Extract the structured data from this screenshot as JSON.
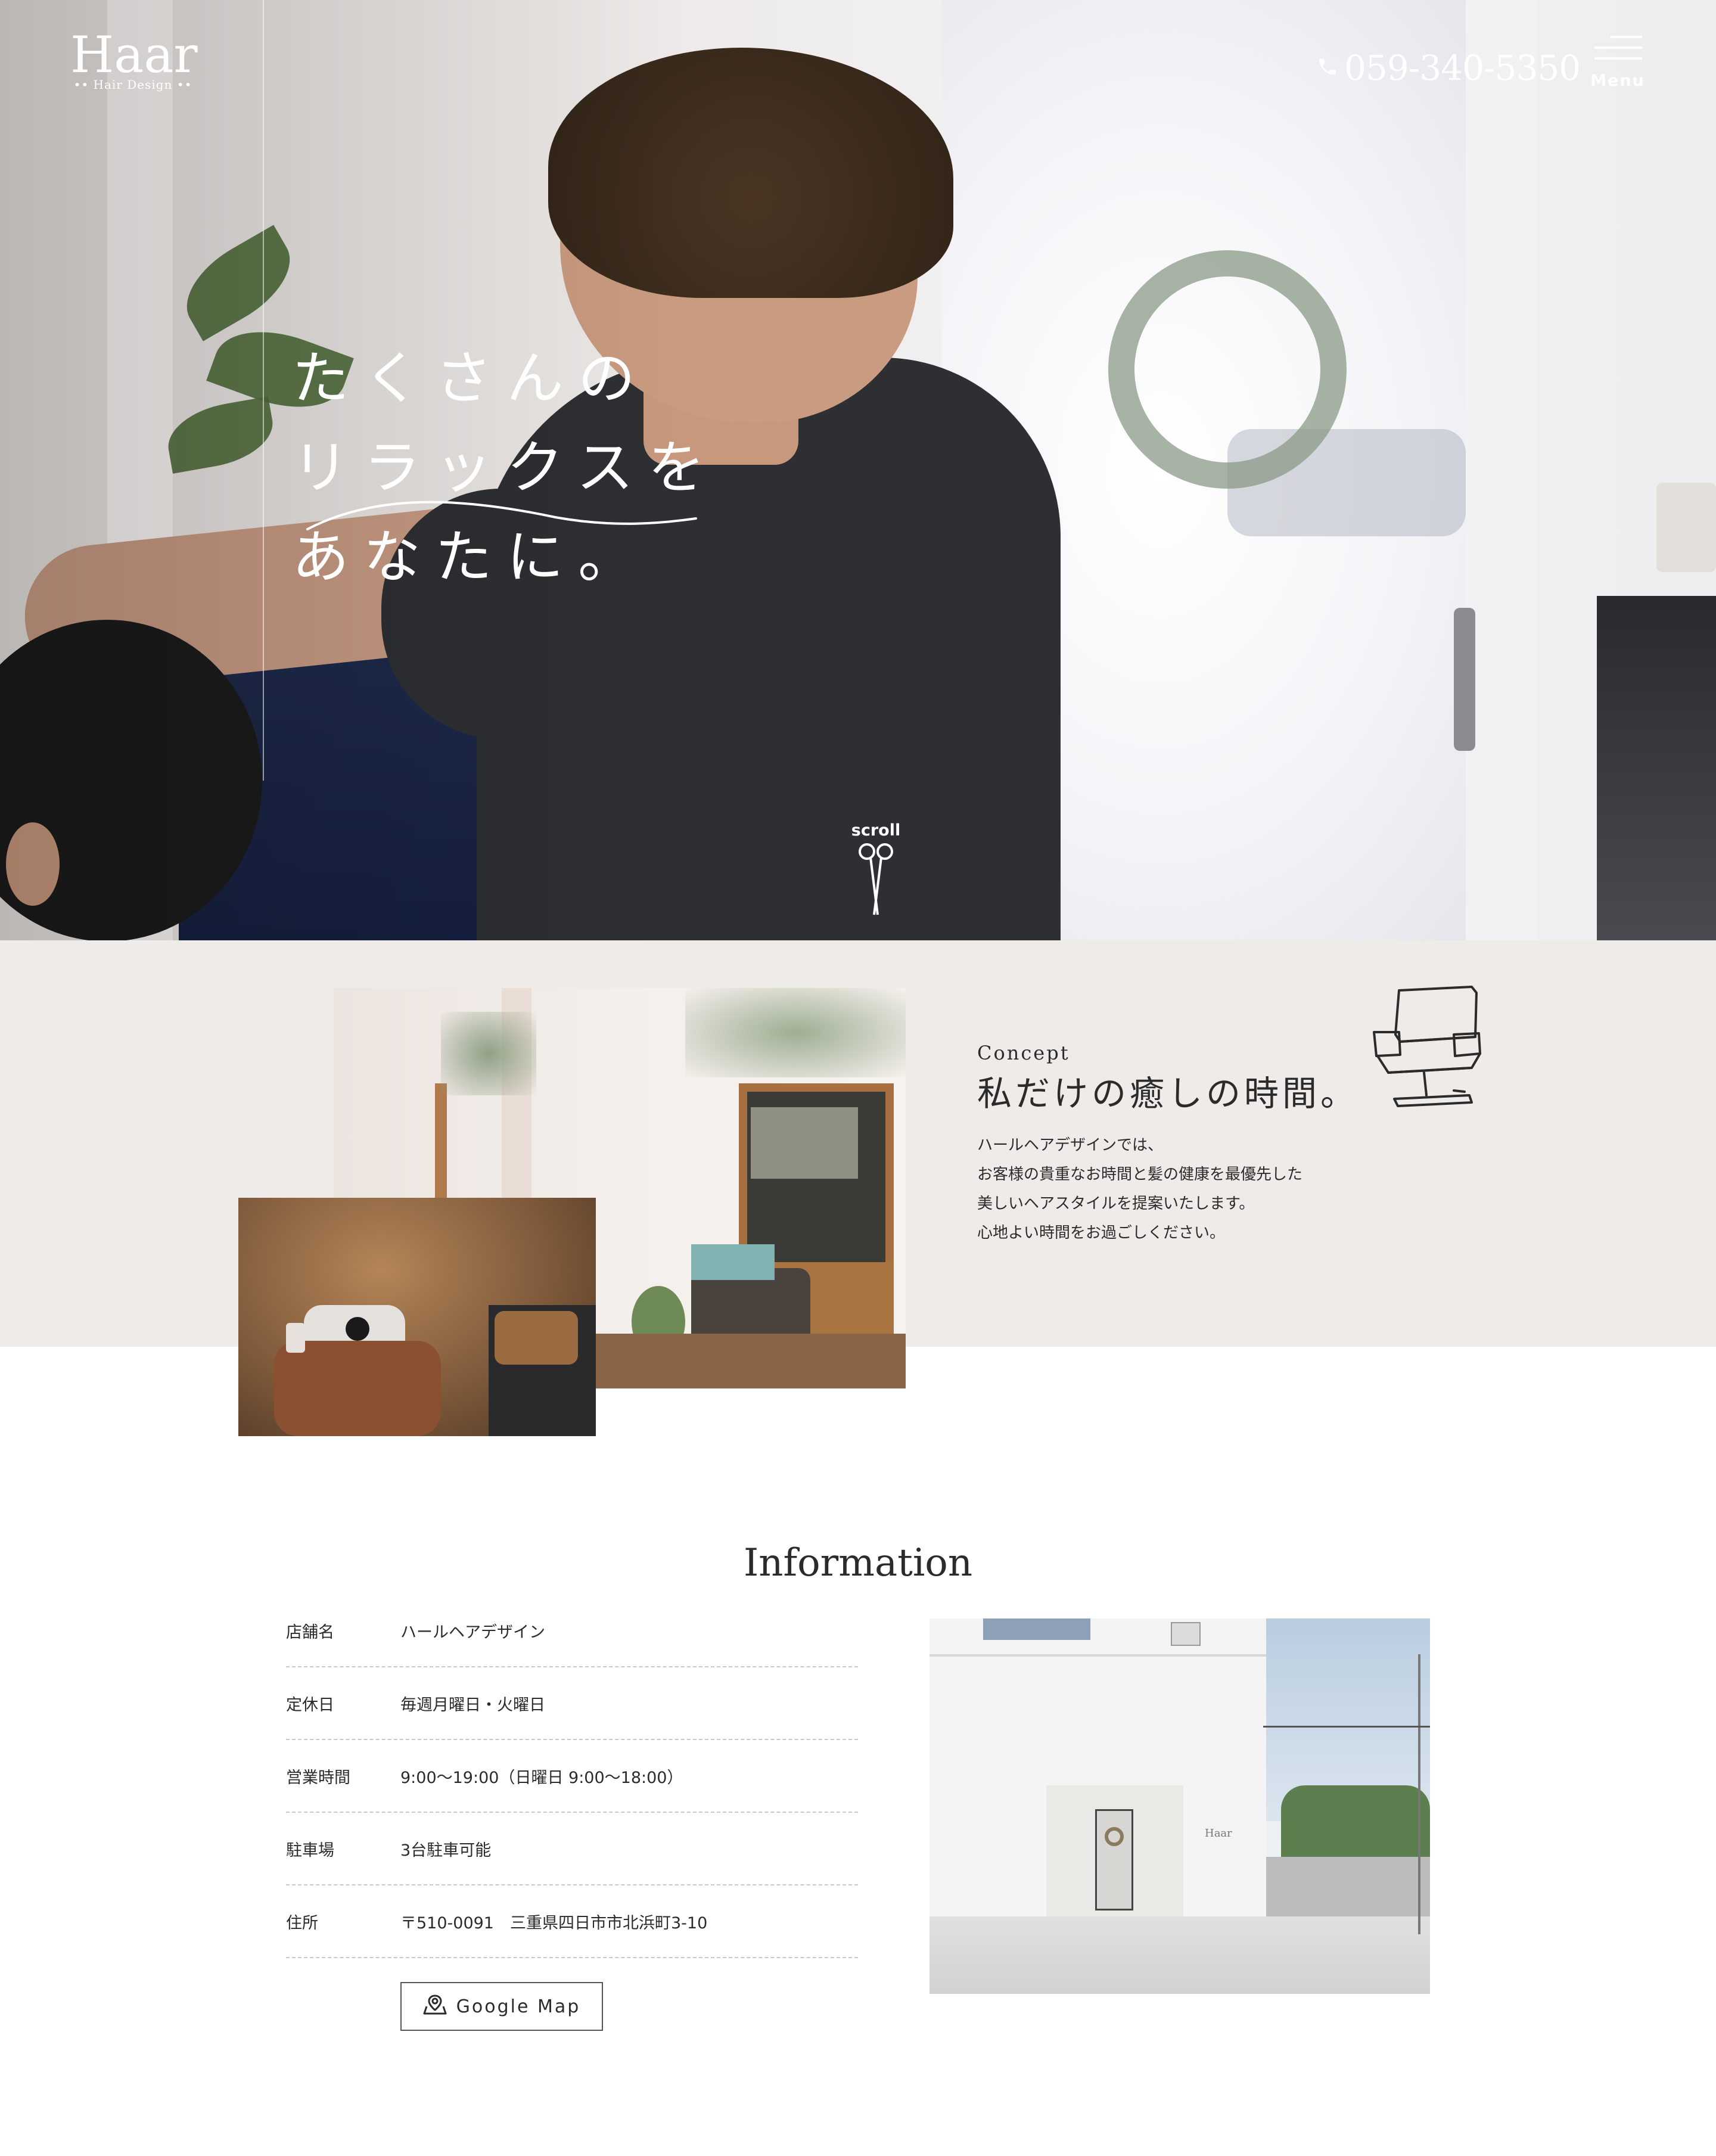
{
  "header": {
    "logo": {
      "name": "Haar",
      "sub": "•• Hair Design ••"
    },
    "phone": "059-340-5350",
    "menu_label": "Menu"
  },
  "hero": {
    "catch_lines": [
      "たくさんの",
      "リラックスを",
      "あなたに。"
    ],
    "scroll_label": "scroll"
  },
  "concept": {
    "label": "Concept",
    "title": "私だけの癒しの時間。",
    "body_lines": [
      "ハールヘアデザインでは、",
      "お客様の貴重なお時間と髪の健康を最優先した",
      "美しいヘアスタイルを提案いたします。",
      "心地よい時間をお過ごしください。"
    ]
  },
  "information": {
    "title": "Information",
    "rows": [
      {
        "key": "店舗名",
        "value": "ハールヘアデザイン"
      },
      {
        "key": "定休日",
        "value": "毎週月曜日・火曜日"
      },
      {
        "key": "営業時間",
        "value": "9:00〜19:00（日曜日 9:00〜18:00）"
      },
      {
        "key": "駐車場",
        "value": "3台駐車可能"
      },
      {
        "key": "住所",
        "value": "〒510-0091　三重県四日市市北浜町3-10"
      }
    ],
    "map_button": "Google Map",
    "shop_sign": "Haar"
  },
  "icons": {
    "phone": "phone-icon",
    "menu": "hamburger-icon",
    "scroll": "scissors-icon",
    "concept": "salon-chair-icon",
    "map": "map-pin-icon"
  },
  "colors": {
    "concept_bg": "#eeebe9",
    "text": "#2b2b2b",
    "divider": "#c9c9c9",
    "hero_text": "#ffffff"
  }
}
